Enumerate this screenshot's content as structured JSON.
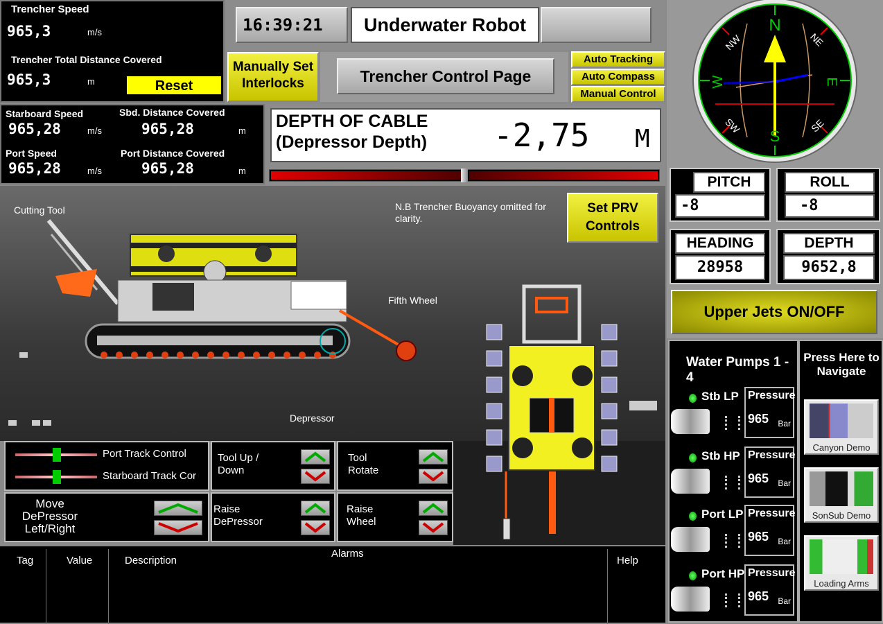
{
  "top_left": {
    "trencher_speed_label": "Trencher Speed",
    "trencher_speed_value": "965,3",
    "trencher_speed_unit": "m/s",
    "total_distance_label": "Trencher Total Distance Covered",
    "total_distance_value": "965,3",
    "total_distance_unit": "m",
    "reset_label": "Reset"
  },
  "speeds": {
    "stbd_speed_label": "Starboard Speed",
    "stbd_speed_value": "965,28",
    "stbd_speed_unit": "m/s",
    "stbd_dist_label": "Sbd. Distance Covered",
    "stbd_dist_value": "965,28",
    "stbd_dist_unit": "m",
    "port_speed_label": "Port Speed",
    "port_speed_value": "965,28",
    "port_speed_unit": "m/s",
    "port_dist_label": "Port Distance Covered",
    "port_dist_value": "965,28",
    "port_dist_unit": "m"
  },
  "header": {
    "time": "16:39:21",
    "title": "Underwater Robot",
    "manual_interlocks": "Manually Set Interlocks",
    "page_title": "Trencher Control Page",
    "auto_tracking": "Auto Tracking",
    "auto_compass": "Auto Compass",
    "manual_control": "Manual Control"
  },
  "depth_cable": {
    "label_line1": "DEPTH OF CABLE",
    "label_line2": "(Depressor Depth)",
    "value": "-2,75",
    "unit": "M",
    "bar_level": 0.5
  },
  "compass": {
    "n": "N",
    "s": "S",
    "e": "E",
    "w": "W",
    "ne": "NE",
    "nw": "NW",
    "se": "SE",
    "sw": "SW"
  },
  "instruments": {
    "pitch_label": "PITCH",
    "pitch_value": "-8",
    "roll_label": "ROLL",
    "roll_value": "-8",
    "heading_label": "HEADING",
    "heading_value": "28958",
    "depth_label": "DEPTH",
    "depth_value": "9652,8"
  },
  "upper_jets": "Upper Jets ON/OFF",
  "pumps": {
    "title": "Water Pumps 1 - 4",
    "items": [
      {
        "name": "Stb LP",
        "pressure_label": "Pressure",
        "value": "965",
        "unit": "Bar"
      },
      {
        "name": "Stb HP",
        "pressure_label": "Pressure",
        "value": "965",
        "unit": "Bar"
      },
      {
        "name": "Port LP",
        "pressure_label": "Pressure",
        "value": "965",
        "unit": "Bar"
      },
      {
        "name": "Port HP",
        "pressure_label": "Pressure",
        "value": "965",
        "unit": "Bar"
      }
    ]
  },
  "navigate": {
    "title": "Press Here to Navigate",
    "items": [
      "Canyon Demo",
      "SonSub Demo",
      "Loading Arms"
    ]
  },
  "diagram": {
    "cutting_tool": "Cutting Tool",
    "note": "N.B Trencher Buoyancy omitted for clarity.",
    "set_prv": "Set PRV Controls",
    "fifth_wheel": "Fifth Wheel",
    "depressor": "Depressor"
  },
  "controls": {
    "port_track": "Port Track Control",
    "stbd_track": "Starboard Track Cor",
    "tool_updown": "Tool Up / Down",
    "tool_rotate": "Tool Rotate",
    "move_depressor": "Move DePressor Left/Right",
    "raise_depressor": "Raise DePressor",
    "raise_wheel": "Raise Wheel"
  },
  "alarms": {
    "title": "Alarms",
    "col_tag": "Tag",
    "col_value": "Value",
    "col_description": "Description",
    "col_help": "Help"
  }
}
